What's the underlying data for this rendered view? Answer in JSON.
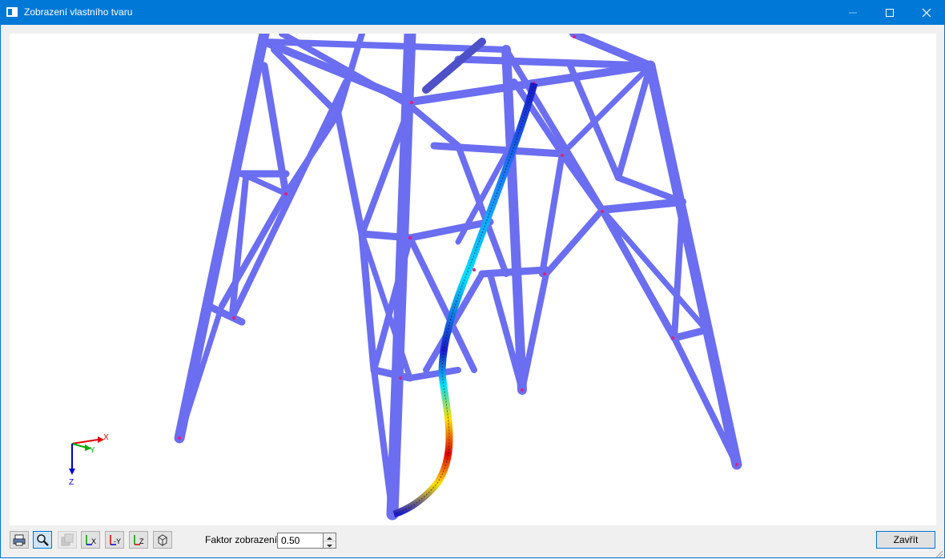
{
  "window": {
    "title": "Zobrazení vlastního tvaru",
    "buttons": {
      "minimize": "minimize-icon",
      "maximize": "maximize-icon",
      "close": "close-icon"
    }
  },
  "viewport": {
    "model": "steel-lattice-tower-mode-shape",
    "structure_color": "#6b6ef0",
    "deformed_member_colors": [
      "#1a1acc",
      "#00c8ff",
      "#ffe000",
      "#e00000"
    ],
    "axes": {
      "x": "X",
      "y": "Y",
      "z": "Z"
    },
    "axis_colors": {
      "x": "#e00000",
      "y": "#00b000",
      "z": "#0000d0"
    }
  },
  "toolbar": {
    "buttons": [
      {
        "name": "print-button",
        "icon": "printer-icon",
        "state": "normal"
      },
      {
        "name": "zoom-button",
        "icon": "magnifier-icon",
        "state": "active"
      },
      {
        "name": "render-button",
        "icon": "render-icon",
        "state": "disabled"
      },
      {
        "name": "view-x-button",
        "icon": "view-x-icon",
        "label": "X"
      },
      {
        "name": "view-minus-y-button",
        "icon": "view-minus-y-icon",
        "label": "-Y"
      },
      {
        "name": "view-z-button",
        "icon": "view-z-icon",
        "label": "Z"
      },
      {
        "name": "view-iso-button",
        "icon": "view-iso-icon",
        "state": "normal"
      }
    ],
    "factor_label": "Faktor zobrazení:",
    "factor_value": "0.50",
    "close_label": "Zavřít"
  }
}
